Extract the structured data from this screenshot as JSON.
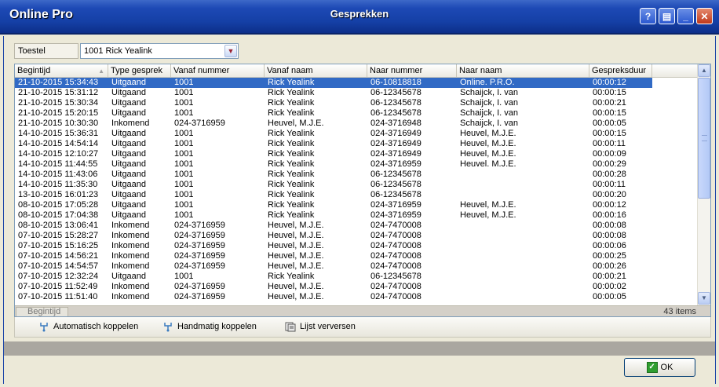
{
  "titlebar": {
    "app_name": "Online Pro",
    "window_title": "Gesprekken",
    "help_glyph": "?",
    "export_glyph": "▤",
    "minimize_glyph": "_",
    "close_glyph": "✕"
  },
  "filter": {
    "label": "Toestel",
    "selected": "1001 Rick Yealink",
    "arrow_glyph": "▼"
  },
  "table": {
    "sort_glyph": "▲",
    "columns": [
      "Begintijd",
      "Type gesprek",
      "Vanaf nummer",
      "Vanaf naam",
      "Naar nummer",
      "Naar naam",
      "Gespreksduur"
    ],
    "rows": [
      [
        "21-10-2015 15:34:43",
        "Uitgaand",
        "1001",
        "Rick Yealink",
        "06-10818818",
        "Online. P.R.O.",
        "00:00:12"
      ],
      [
        "21-10-2015 15:31:12",
        "Uitgaand",
        "1001",
        "Rick Yealink",
        "06-12345678",
        "Schaijck, I. van",
        "00:00:15"
      ],
      [
        "21-10-2015 15:30:34",
        "Uitgaand",
        "1001",
        "Rick Yealink",
        "06-12345678",
        "Schaijck, I. van",
        "00:00:21"
      ],
      [
        "21-10-2015 15:20:15",
        "Uitgaand",
        "1001",
        "Rick Yealink",
        "06-12345678",
        "Schaijck, I. van",
        "00:00:15"
      ],
      [
        "21-10-2015 10:30:30",
        "Inkomend",
        "024-3716959",
        "Heuvel, M.J.E.",
        "024-3716948",
        "Schaijck, I. van",
        "00:00:05"
      ],
      [
        "14-10-2015 15:36:31",
        "Uitgaand",
        "1001",
        "Rick Yealink",
        "024-3716949",
        "Heuvel, M.J.E.",
        "00:00:15"
      ],
      [
        "14-10-2015 14:54:14",
        "Uitgaand",
        "1001",
        "Rick Yealink",
        "024-3716949",
        "Heuvel, M.J.E.",
        "00:00:11"
      ],
      [
        "14-10-2015 12:10:27",
        "Uitgaand",
        "1001",
        "Rick Yealink",
        "024-3716949",
        "Heuvel, M.J.E.",
        "00:00:09"
      ],
      [
        "14-10-2015 11:44:55",
        "Uitgaand",
        "1001",
        "Rick Yealink",
        "024-3716959",
        "Heuvel. M.J.E.",
        "00:00:29"
      ],
      [
        "14-10-2015 11:43:06",
        "Uitgaand",
        "1001",
        "Rick Yealink",
        "06-12345678",
        "",
        "00:00:28"
      ],
      [
        "14-10-2015 11:35:30",
        "Uitgaand",
        "1001",
        "Rick Yealink",
        "06-12345678",
        "",
        "00:00:11"
      ],
      [
        "13-10-2015 16:01:23",
        "Uitgaand",
        "1001",
        "Rick Yealink",
        "06-12345678",
        "",
        "00:00:20"
      ],
      [
        "08-10-2015 17:05:28",
        "Uitgaand",
        "1001",
        "Rick Yealink",
        "024-3716959",
        "Heuvel, M.J.E.",
        "00:00:12"
      ],
      [
        "08-10-2015 17:04:38",
        "Uitgaand",
        "1001",
        "Rick Yealink",
        "024-3716959",
        "Heuvel, M.J.E.",
        "00:00:16"
      ],
      [
        "08-10-2015 13:06:41",
        "Inkomend",
        "024-3716959",
        "Heuvel, M.J.E.",
        "024-7470008",
        "",
        "00:00:08"
      ],
      [
        "07-10-2015 15:28:27",
        "Inkomend",
        "024-3716959",
        "Heuvel, M.J.E.",
        "024-7470008",
        "",
        "00:00:08"
      ],
      [
        "07-10-2015 15:16:25",
        "Inkomend",
        "024-3716959",
        "Heuvel, M.J.E.",
        "024-7470008",
        "",
        "00:00:06"
      ],
      [
        "07-10-2015 14:56:21",
        "Inkomend",
        "024-3716959",
        "Heuvel, M.J.E.",
        "024-7470008",
        "",
        "00:00:25"
      ],
      [
        "07-10-2015 14:54:57",
        "Inkomend",
        "024-3716959",
        "Heuvel, M.J.E.",
        "024-7470008",
        "",
        "00:00:26"
      ],
      [
        "07-10-2015 12:32:24",
        "Uitgaand",
        "1001",
        "Rick Yealink",
        "06-12345678",
        "",
        "00:00:21"
      ],
      [
        "07-10-2015 11:52:49",
        "Inkomend",
        "024-3716959",
        "Heuvel, M.J.E.",
        "024-7470008",
        "",
        "00:00:02"
      ],
      [
        "07-10-2015 11:51:40",
        "Inkomend",
        "024-3716959",
        "Heuvel, M.J.E.",
        "024-7470008",
        "",
        "00:00:05"
      ]
    ],
    "selected_row": 0,
    "scroll_up_glyph": "▲",
    "scroll_down_glyph": "▼",
    "footer_label": "Begintijd",
    "item_count": "43 items"
  },
  "actions": [
    {
      "label": "Automatisch koppelen",
      "icon": "auto-link-icon"
    },
    {
      "label": "Handmatig koppelen",
      "icon": "manual-link-icon"
    },
    {
      "label": "Lijst verversen",
      "icon": "refresh-list-icon"
    }
  ],
  "dialog": {
    "ok_label": "OK",
    "ok_glyph": "✓"
  },
  "colors": {
    "selection": "#316ac5",
    "titlebar": "#1540a6"
  }
}
